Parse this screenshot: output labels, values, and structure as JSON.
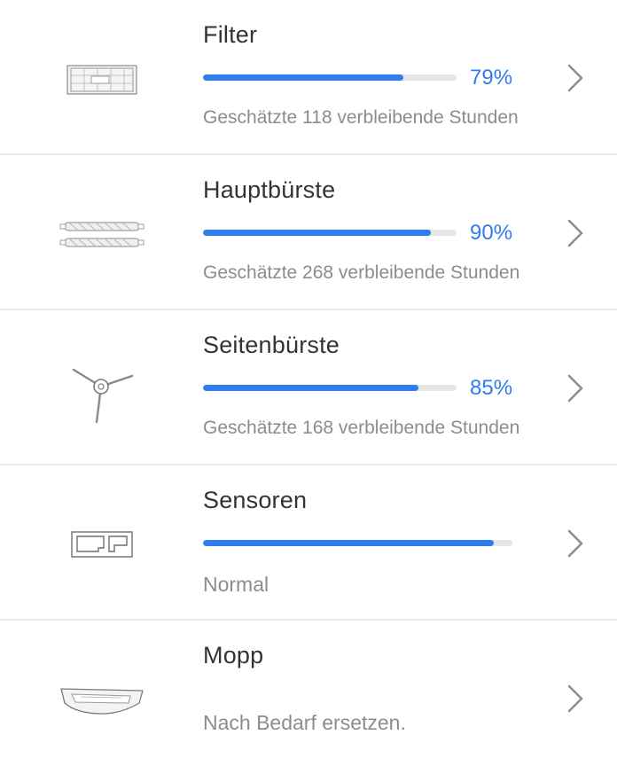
{
  "items": [
    {
      "id": "filter",
      "icon": "filter-icon",
      "title": "Filter",
      "progress": 0.79,
      "percent_label": "79%",
      "subtitle": "Geschätzte 118 verbleibende Stunden"
    },
    {
      "id": "main-brush",
      "icon": "main-brush-icon",
      "title": "Hauptbürste",
      "progress": 0.9,
      "percent_label": "90%",
      "subtitle": "Geschätzte 268 verbleibende Stunden"
    },
    {
      "id": "side-brush",
      "icon": "side-brush-icon",
      "title": "Seitenbürste",
      "progress": 0.85,
      "percent_label": "85%",
      "subtitle": "Geschätzte 168 verbleibende Stunden"
    },
    {
      "id": "sensors",
      "icon": "sensor-icon",
      "title": "Sensoren",
      "progress": 0.94,
      "percent_label": "",
      "subtitle": "Normal"
    },
    {
      "id": "mop",
      "icon": "mop-icon",
      "title": "Mopp",
      "progress": null,
      "percent_label": "",
      "subtitle": "Nach Bedarf ersetzen."
    }
  ],
  "colors": {
    "accent": "#2e7cf0",
    "track": "#e6e6e6",
    "title": "#333333",
    "subtitle": "#8c8c8c",
    "divider": "#e8e8e8"
  }
}
